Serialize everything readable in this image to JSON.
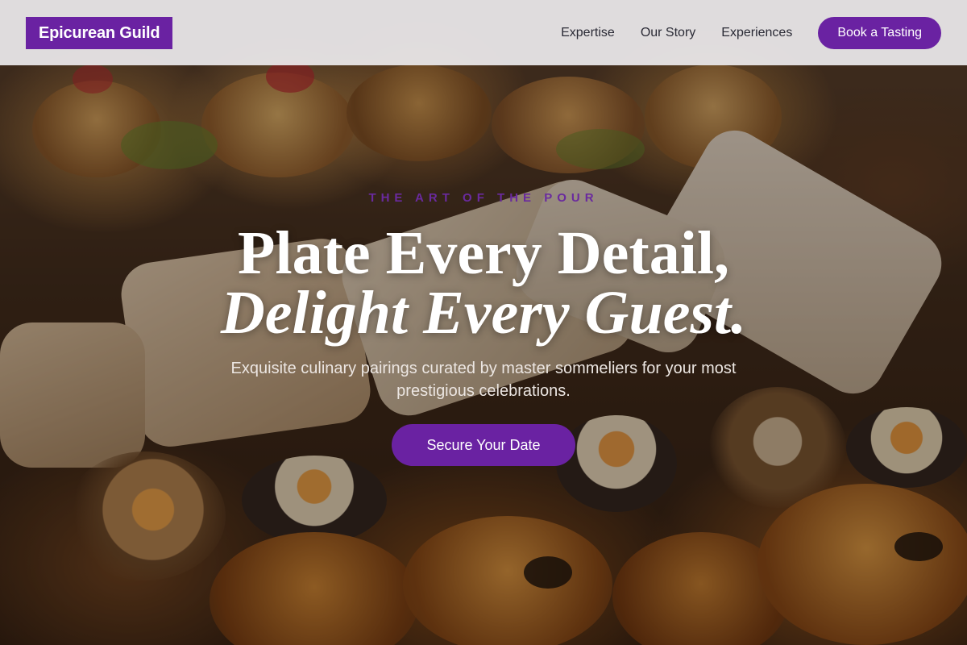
{
  "brand": {
    "logo_text": "Epicurean Guild",
    "accent_color": "#6a22a2"
  },
  "nav": {
    "links": [
      "Expertise",
      "Our Story",
      "Experiences"
    ],
    "cta_label": "Book a Tasting"
  },
  "hero": {
    "eyebrow": "THE ART OF THE POUR",
    "headline_line1": "Plate Every Detail,",
    "headline_line2": "Delight Every Guest.",
    "subtitle": "Exquisite culinary pairings curated by master sommeliers for your most prestigious celebrations.",
    "cta_label": "Secure Your Date"
  }
}
